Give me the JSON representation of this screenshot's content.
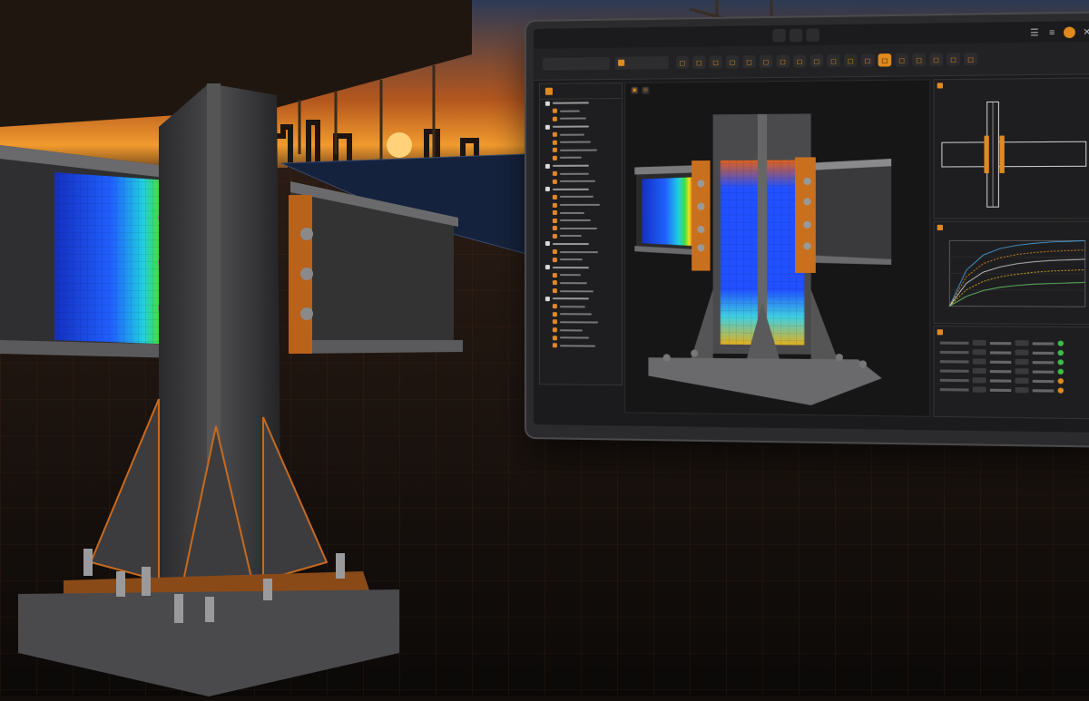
{
  "app": {
    "window_controls": [
      "menu-icon",
      "list-icon",
      "gear-icon",
      "close-icon"
    ],
    "accent_color": "#e08a1e",
    "search": {
      "placeholder": ""
    },
    "active_tab": {
      "label": ""
    }
  },
  "toolbar": {
    "tools": [
      {
        "icon": "select-icon",
        "active": false
      },
      {
        "icon": "node-icon",
        "active": false
      },
      {
        "icon": "rotate-icon",
        "active": false
      },
      {
        "icon": "orbit-icon",
        "active": false
      },
      {
        "icon": "pan-icon",
        "active": false
      },
      {
        "icon": "zoom-icon",
        "active": false
      },
      {
        "icon": "section-icon",
        "active": false
      },
      {
        "icon": "fit-icon",
        "active": false
      },
      {
        "icon": "measure-icon",
        "active": false
      },
      {
        "icon": "bolt-icon",
        "active": false
      },
      {
        "icon": "weld-icon",
        "active": false
      },
      {
        "icon": "plate-icon",
        "active": false
      },
      {
        "icon": "stress-icon",
        "active": true
      },
      {
        "icon": "mesh-icon",
        "active": false
      },
      {
        "icon": "report-icon",
        "active": false
      },
      {
        "icon": "export-icon",
        "active": false
      },
      {
        "icon": "settings-icon",
        "active": false
      },
      {
        "icon": "help-icon",
        "active": false
      }
    ]
  },
  "model_tree": {
    "title": "",
    "groups": [
      {
        "items": 2
      },
      {
        "items": 4
      },
      {
        "items": 2
      },
      {
        "items": 6
      },
      {
        "items": 2
      },
      {
        "items": 3
      },
      {
        "items": 6
      }
    ]
  },
  "panels": {
    "connection": {
      "title": ""
    },
    "chart": {
      "title": ""
    },
    "results": {
      "title": "",
      "rows": 6
    }
  },
  "chart_data": {
    "type": "line",
    "title": "",
    "xlabel": "",
    "ylabel": "",
    "x": [
      0,
      1,
      2,
      3,
      4,
      5,
      6,
      7,
      8
    ],
    "series": [
      {
        "values": [
          0,
          0.55,
          0.78,
          0.88,
          0.93,
          0.96,
          0.98,
          0.99,
          1.0
        ],
        "color": "#4aa3e0"
      },
      {
        "values": [
          0,
          0.45,
          0.65,
          0.74,
          0.79,
          0.82,
          0.84,
          0.85,
          0.86
        ],
        "color": "#e08a1e"
      },
      {
        "values": [
          0,
          0.35,
          0.52,
          0.6,
          0.65,
          0.68,
          0.7,
          0.71,
          0.72
        ],
        "color": "#d9d9d9"
      },
      {
        "values": [
          0,
          0.25,
          0.38,
          0.45,
          0.49,
          0.52,
          0.54,
          0.55,
          0.56
        ],
        "color": "#e0b21e"
      },
      {
        "values": [
          0,
          0.15,
          0.24,
          0.29,
          0.32,
          0.34,
          0.35,
          0.36,
          0.37
        ],
        "color": "#6c6"
      }
    ],
    "grid": true
  }
}
